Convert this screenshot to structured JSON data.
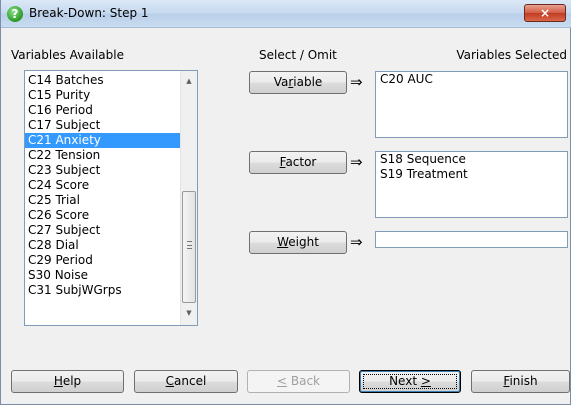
{
  "window": {
    "title": "Break-Down: Step 1",
    "close_glyph": "×",
    "app_icon": "?"
  },
  "labels": {
    "available": "Variables Available",
    "select_omit": "Select / Omit",
    "selected": "Variables Selected"
  },
  "available_items": [
    "C14 Batches",
    "C15 Purity",
    "C16 Period",
    "C17 Subject",
    "C21 Anxiety",
    "C22 Tension",
    "C23 Subject",
    "C24 Score",
    "C25 Trial",
    "C26 Score",
    "C27 Subject",
    "C28 Dial",
    "C29 Period",
    "S30 Noise",
    "C31 SubjWGrps"
  ],
  "selected_index": 4,
  "roles": {
    "variable": {
      "label_pre": "Va",
      "label_key": "r",
      "label_post": "iable",
      "items": [
        "C20 AUC"
      ]
    },
    "factor": {
      "label_pre": "",
      "label_key": "F",
      "label_post": "actor",
      "items": [
        "S18 Sequence",
        "S19 Treatment"
      ]
    },
    "weight": {
      "label_pre": "",
      "label_key": "W",
      "label_post": "eight",
      "items": []
    }
  },
  "arrow_glyph": "⇒",
  "buttons": {
    "help": {
      "pre": "",
      "key": "H",
      "post": "elp"
    },
    "cancel": {
      "pre": "",
      "key": "C",
      "post": "ancel"
    },
    "back": {
      "pre": "",
      "key": "<",
      "post": " Back"
    },
    "next": {
      "pre": "Next ",
      "key": ">",
      "post": ""
    },
    "finish": {
      "pre": "",
      "key": "F",
      "post": "inish"
    }
  },
  "colors": {
    "selection": "#3399ff",
    "dialog_bg": "#f0f0f0",
    "close_red": "#c03c22"
  }
}
